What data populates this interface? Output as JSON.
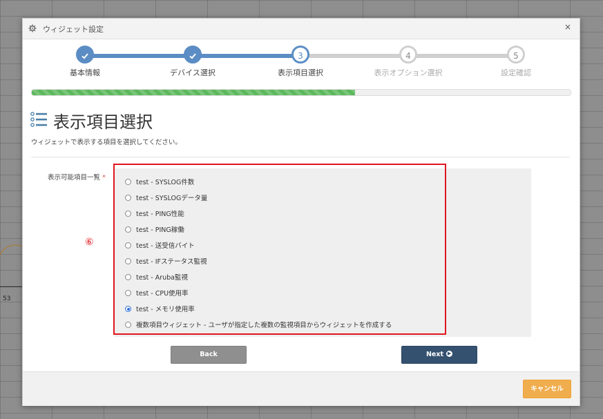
{
  "dialog": {
    "title": "ウィジェット設定",
    "close_symbol": "×"
  },
  "steps": [
    {
      "number": "1",
      "label": "基本情報",
      "state": "done"
    },
    {
      "number": "2",
      "label": "デバイス選択",
      "state": "done"
    },
    {
      "number": "3",
      "label": "表示項目選択",
      "state": "current"
    },
    {
      "number": "4",
      "label": "表示オプション選択",
      "state": "todo"
    },
    {
      "number": "5",
      "label": "設定確認",
      "state": "todo"
    }
  ],
  "progress": {
    "fraction": 0.6
  },
  "page": {
    "title": "表示項目選択",
    "description": "ウィジェットで表示する項目を選択してください。"
  },
  "field": {
    "label": "表示可能項目一覧",
    "required_mark": "*"
  },
  "options": [
    {
      "label": "test - SYSLOG件数",
      "checked": false
    },
    {
      "label": "test - SYSLOGデータ量",
      "checked": false
    },
    {
      "label": "test - PING性能",
      "checked": false
    },
    {
      "label": "test - PING稼働",
      "checked": false
    },
    {
      "label": "test - 送受信バイト",
      "checked": false
    },
    {
      "label": "test - IFステータス監視",
      "checked": false
    },
    {
      "label": "test - Aruba監視",
      "checked": false
    },
    {
      "label": "test - CPU使用率",
      "checked": false
    },
    {
      "label": "test - メモリ使用率",
      "checked": true
    },
    {
      "label": "複数項目ウィジェット - ユーザが指定した複数の監視項目からウィジェットを作成する",
      "checked": false
    }
  ],
  "annotation": "⑥",
  "buttons": {
    "back": "Back",
    "next": "Next",
    "cancel": "キャンセル"
  },
  "background": {
    "tick_label": "53"
  },
  "colors": {
    "step_active": "#5b8dc4",
    "step_inactive": "#cfcfcf",
    "progress": "#5cb85c",
    "next_button": "#34516f",
    "cancel_button": "#f0ad4e",
    "highlight": "#e0141e"
  },
  "icons": {
    "header": "gear-icon",
    "page": "list-icon",
    "done_step": "check-icon",
    "next": "arrow-right-circle-icon"
  }
}
